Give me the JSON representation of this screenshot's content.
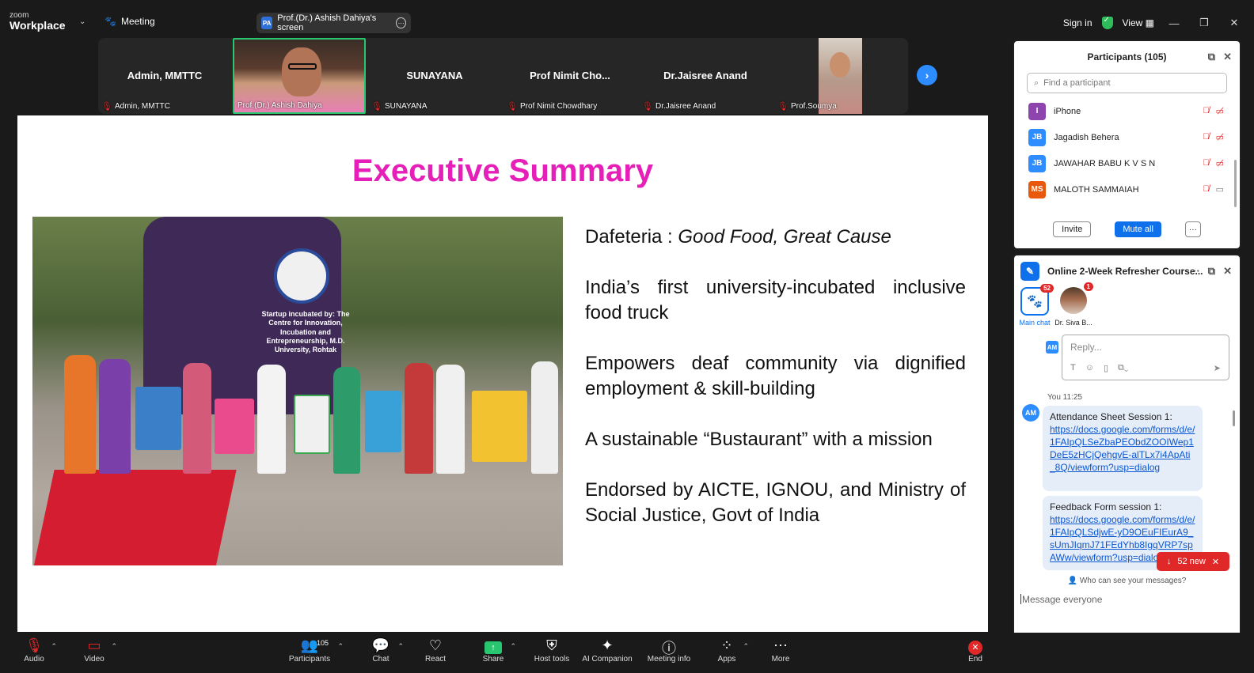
{
  "app": {
    "brand_small": "zoom",
    "brand": "Workplace"
  },
  "topbar": {
    "meeting_label": "Meeting",
    "screen_badge": "PA",
    "screen_label": "Prof.(Dr.) Ashish Dahiya's screen",
    "sign_in": "Sign in",
    "view_label": "View"
  },
  "gallery": {
    "tiles": [
      {
        "name": "Admin, MMTTC",
        "label": "Admin, MMTTC"
      },
      {
        "name": "",
        "label": "Prof.(Dr.) Ashish Dahiya"
      },
      {
        "name": "SUNAYANA",
        "label": "SUNAYANA"
      },
      {
        "name": "Prof Nimit Cho...",
        "label": "Prof Nimit Chowdhary"
      },
      {
        "name": "Dr.Jaisree Anand",
        "label": "Dr.Jaisree Anand"
      },
      {
        "name": "",
        "label": "Prof.Soumya"
      }
    ]
  },
  "slide": {
    "title": "Executive Summary",
    "bus_text": "Startup incubated by: The Centre for Innovation, Incubation and Entrepreneurship, M.D. University, Rohtak",
    "bullet1_prefix": "Dafeteria : ",
    "bullet1_italic": "Good Food, Great Cause",
    "bullet2": "India’s first university-incubated inclusive food truck",
    "bullet3": "Empowers deaf community via dignified employment & skill-building",
    "bullet4": "A sustainable “Bustaurant” with a mission",
    "bullet5": "Endorsed by AICTE, IGNOU, and Ministry of Social Justice, Govt of India"
  },
  "participants": {
    "title": "Participants (105)",
    "search_placeholder": "Find a participant",
    "list": [
      {
        "initials": "I",
        "name": "iPhone",
        "color": "#8e44ad"
      },
      {
        "initials": "JB",
        "name": "Jagadish Behera",
        "color": "#2d8cff"
      },
      {
        "initials": "JB",
        "name": "JAWAHAR BABU K V S N",
        "color": "#2d8cff"
      },
      {
        "initials": "MS",
        "name": "MALOTH SAMMAIAH",
        "color": "#e8590c"
      }
    ],
    "invite": "Invite",
    "mute_all": "Mute all",
    "more": "···"
  },
  "chat": {
    "title": "Online 2-Week Refresher Course...",
    "main_chat_label": "Main chat",
    "main_chat_badge": "52",
    "siva_label": "Dr. Siva B...",
    "siva_badge": "1",
    "reply_avatar": "AM",
    "reply_placeholder": "Reply...",
    "msg_time": "You 11:25",
    "msg_avatar": "AM",
    "msg1_title": "Attendance Sheet Session 1:",
    "msg1_link": "https://docs.google.com/forms/d/e/1FAIpQLSeZbaPEObdZOOIWep1DeE5zHCjQehgvE-alTLx7i4ApAti_8Q/viewform?usp=dialog",
    "msg2_title": "Feedback Form session 1:",
    "msg2_link": "https://docs.google.com/forms/d/e/1FAIpQLSdjwE-yD9OEuFIEurA9_sUmJIqmJ71FEdYhb8IgqVRP7spAWw/viewform?usp=dialog",
    "new_count": "52 new",
    "who_can_see": "Who can see your messages?",
    "message_placeholder": "Message everyone"
  },
  "toolbar": {
    "audio": "Audio",
    "video": "Video",
    "participants": "Participants",
    "participants_count": "105",
    "chat": "Chat",
    "react": "React",
    "share": "Share",
    "host_tools": "Host tools",
    "ai_companion": "AI Companion",
    "meeting_info": "Meeting info",
    "apps": "Apps",
    "more": "More",
    "end": "End"
  }
}
